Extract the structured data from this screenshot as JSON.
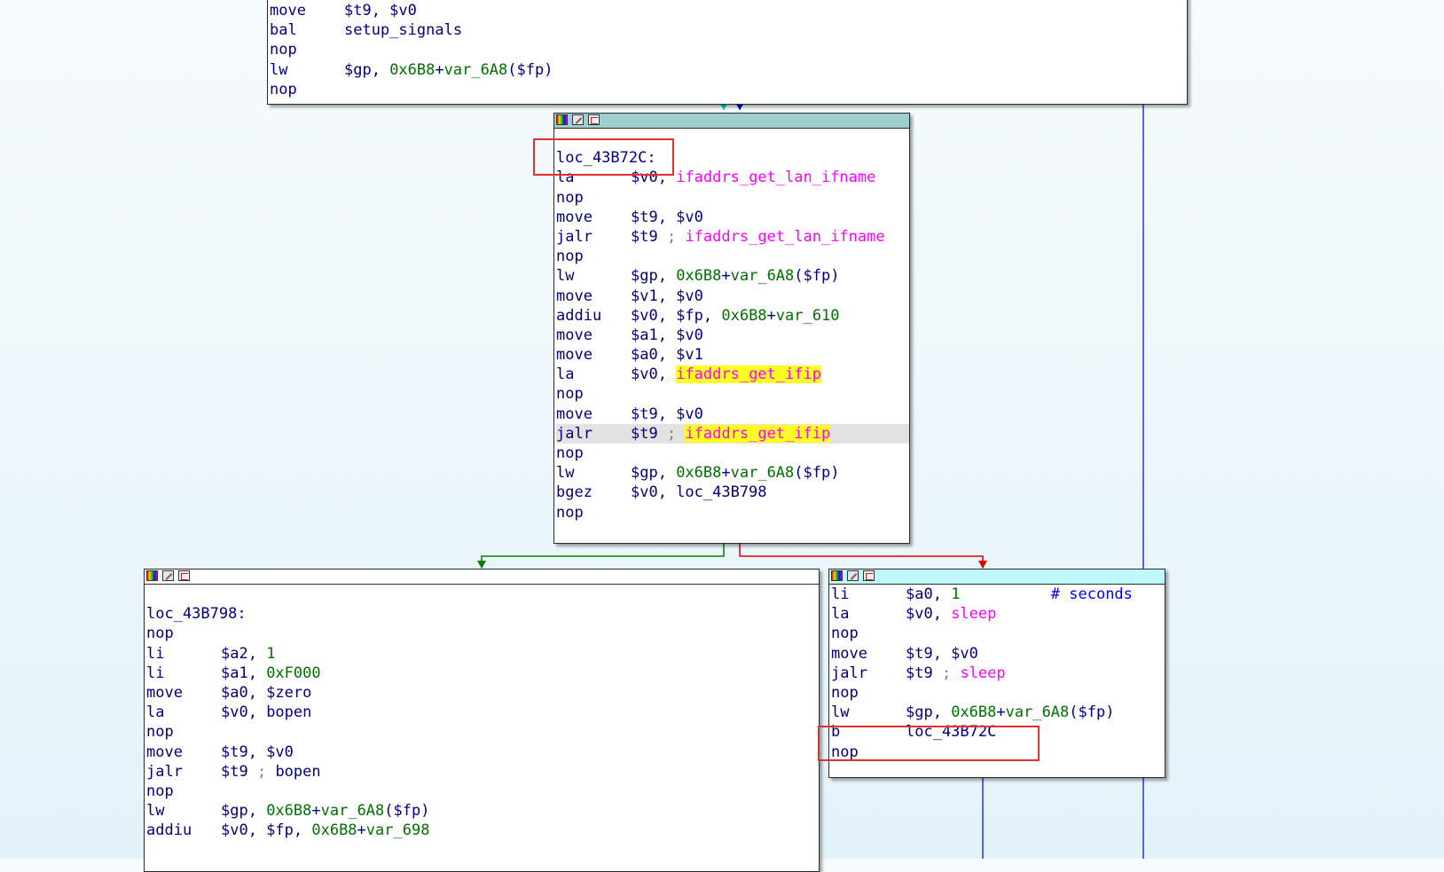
{
  "node_top": {
    "lines": [
      {
        "mn": "move",
        "ops": [
          {
            "t": "$t9, $v0",
            "c": "op"
          }
        ]
      },
      {
        "mn": "bal",
        "ops": [
          {
            "t": "setup_signals",
            "c": "op"
          }
        ]
      },
      {
        "mn": "nop",
        "ops": []
      },
      {
        "mn": "lw",
        "ops": [
          {
            "t": "$gp, ",
            "c": "op"
          },
          {
            "t": "0x6B8",
            "c": "num"
          },
          {
            "t": "+",
            "c": "op"
          },
          {
            "t": "var_6A8",
            "c": "var"
          },
          {
            "t": "($fp)",
            "c": "op"
          }
        ]
      },
      {
        "mn": "nop",
        "ops": []
      }
    ]
  },
  "node_mid": {
    "lines": [
      {
        "label": ""
      },
      {
        "label": "loc_43B72C:"
      },
      {
        "mn": "la",
        "ops": [
          {
            "t": "$v0, ",
            "c": "op"
          },
          {
            "t": "ifaddrs_get_lan_ifname",
            "c": "fn"
          }
        ]
      },
      {
        "mn": "nop",
        "ops": []
      },
      {
        "mn": "move",
        "ops": [
          {
            "t": "$t9, $v0",
            "c": "op"
          }
        ]
      },
      {
        "mn": "jalr",
        "ops": [
          {
            "t": "$t9 ",
            "c": "op"
          },
          {
            "t": "; ",
            "c": "cmt"
          },
          {
            "t": "ifaddrs_get_lan_ifname",
            "c": "fn"
          }
        ]
      },
      {
        "mn": "nop",
        "ops": []
      },
      {
        "mn": "lw",
        "ops": [
          {
            "t": "$gp, ",
            "c": "op"
          },
          {
            "t": "0x6B8",
            "c": "num"
          },
          {
            "t": "+",
            "c": "op"
          },
          {
            "t": "var_6A8",
            "c": "var"
          },
          {
            "t": "($fp)",
            "c": "op"
          }
        ]
      },
      {
        "mn": "move",
        "ops": [
          {
            "t": "$v1, $v0",
            "c": "op"
          }
        ]
      },
      {
        "mn": "addiu",
        "ops": [
          {
            "t": "$v0, $fp, ",
            "c": "op"
          },
          {
            "t": "0x6B8",
            "c": "num"
          },
          {
            "t": "+",
            "c": "op"
          },
          {
            "t": "var_610",
            "c": "var"
          }
        ]
      },
      {
        "mn": "move",
        "ops": [
          {
            "t": "$a1, $v0",
            "c": "op"
          }
        ]
      },
      {
        "mn": "move",
        "ops": [
          {
            "t": "$a0, $v1",
            "c": "op"
          }
        ]
      },
      {
        "mn": "la",
        "ops": [
          {
            "t": "$v0, ",
            "c": "op"
          },
          {
            "t": "ifaddrs_get_ifip",
            "c": "fn hl"
          }
        ]
      },
      {
        "mn": "nop",
        "ops": []
      },
      {
        "mn": "move",
        "ops": [
          {
            "t": "$t9, $v0",
            "c": "op"
          }
        ]
      },
      {
        "mn": "jalr",
        "cur": true,
        "ops": [
          {
            "t": "$t9 ",
            "c": "op"
          },
          {
            "t": "; ",
            "c": "cmt"
          },
          {
            "t": "ifaddrs_get_ifip",
            "c": "fn hl"
          }
        ]
      },
      {
        "mn": "nop",
        "ops": []
      },
      {
        "mn": "lw",
        "ops": [
          {
            "t": "$gp, ",
            "c": "op"
          },
          {
            "t": "0x6B8",
            "c": "num"
          },
          {
            "t": "+",
            "c": "op"
          },
          {
            "t": "var_6A8",
            "c": "var"
          },
          {
            "t": "($fp)",
            "c": "op"
          }
        ]
      },
      {
        "mn": "bgez",
        "ops": [
          {
            "t": "$v0, loc_43B798",
            "c": "op"
          }
        ]
      },
      {
        "mn": "nop",
        "ops": []
      }
    ]
  },
  "node_left": {
    "lines": [
      {
        "label": ""
      },
      {
        "label": "loc_43B798:"
      },
      {
        "mn": "nop",
        "ops": []
      },
      {
        "mn": "li",
        "ops": [
          {
            "t": "$a2, ",
            "c": "op"
          },
          {
            "t": "1",
            "c": "num"
          }
        ]
      },
      {
        "mn": "li",
        "ops": [
          {
            "t": "$a1, ",
            "c": "op"
          },
          {
            "t": "0xF000",
            "c": "num"
          }
        ]
      },
      {
        "mn": "move",
        "ops": [
          {
            "t": "$a0, $zero",
            "c": "op"
          }
        ]
      },
      {
        "mn": "la",
        "ops": [
          {
            "t": "$v0, ",
            "c": "op"
          },
          {
            "t": "bopen",
            "c": "op"
          }
        ]
      },
      {
        "mn": "nop",
        "ops": []
      },
      {
        "mn": "move",
        "ops": [
          {
            "t": "$t9, $v0",
            "c": "op"
          }
        ]
      },
      {
        "mn": "jalr",
        "ops": [
          {
            "t": "$t9 ",
            "c": "op"
          },
          {
            "t": "; ",
            "c": "cmt"
          },
          {
            "t": "bopen",
            "c": "op"
          }
        ]
      },
      {
        "mn": "nop",
        "ops": []
      },
      {
        "mn": "lw",
        "ops": [
          {
            "t": "$gp, ",
            "c": "op"
          },
          {
            "t": "0x6B8",
            "c": "num"
          },
          {
            "t": "+",
            "c": "op"
          },
          {
            "t": "var_6A8",
            "c": "var"
          },
          {
            "t": "($fp)",
            "c": "op"
          }
        ]
      },
      {
        "mn": "addiu",
        "ops": [
          {
            "t": "$v0, $fp, ",
            "c": "op"
          },
          {
            "t": "0x6B8",
            "c": "num"
          },
          {
            "t": "+",
            "c": "op"
          },
          {
            "t": "var_698",
            "c": "var"
          }
        ]
      }
    ]
  },
  "node_right": {
    "lines": [
      {
        "mn": "li",
        "ops": [
          {
            "t": "$a0, ",
            "c": "op"
          },
          {
            "t": "1",
            "c": "num"
          },
          {
            "t": "          # seconds",
            "c": "bluecmt"
          }
        ]
      },
      {
        "mn": "la",
        "ops": [
          {
            "t": "$v0, ",
            "c": "op"
          },
          {
            "t": "sleep",
            "c": "fn"
          }
        ]
      },
      {
        "mn": "nop",
        "ops": []
      },
      {
        "mn": "move",
        "ops": [
          {
            "t": "$t9, $v0",
            "c": "op"
          }
        ]
      },
      {
        "mn": "jalr",
        "ops": [
          {
            "t": "$t9 ",
            "c": "op"
          },
          {
            "t": "; ",
            "c": "cmt"
          },
          {
            "t": "sleep",
            "c": "fn"
          }
        ]
      },
      {
        "mn": "nop",
        "ops": []
      },
      {
        "mn": "lw",
        "ops": [
          {
            "t": "$gp, ",
            "c": "op"
          },
          {
            "t": "0x6B8",
            "c": "num"
          },
          {
            "t": "+",
            "c": "op"
          },
          {
            "t": "var_6A8",
            "c": "var"
          },
          {
            "t": "($fp)",
            "c": "op"
          }
        ]
      },
      {
        "mn": "b",
        "ops": [
          {
            "t": "loc_43B72C",
            "c": "op"
          }
        ]
      },
      {
        "mn": "nop",
        "ops": []
      }
    ]
  },
  "colors": {
    "header_mid": "#9ecece",
    "header_right": "#bff7fb",
    "header_left": "#ffffff",
    "edge_true": "#008000",
    "edge_false": "#e00000",
    "edge_back": "#0000e0",
    "edge_cyan": "#00d0e0",
    "annotation": "#e03030"
  }
}
